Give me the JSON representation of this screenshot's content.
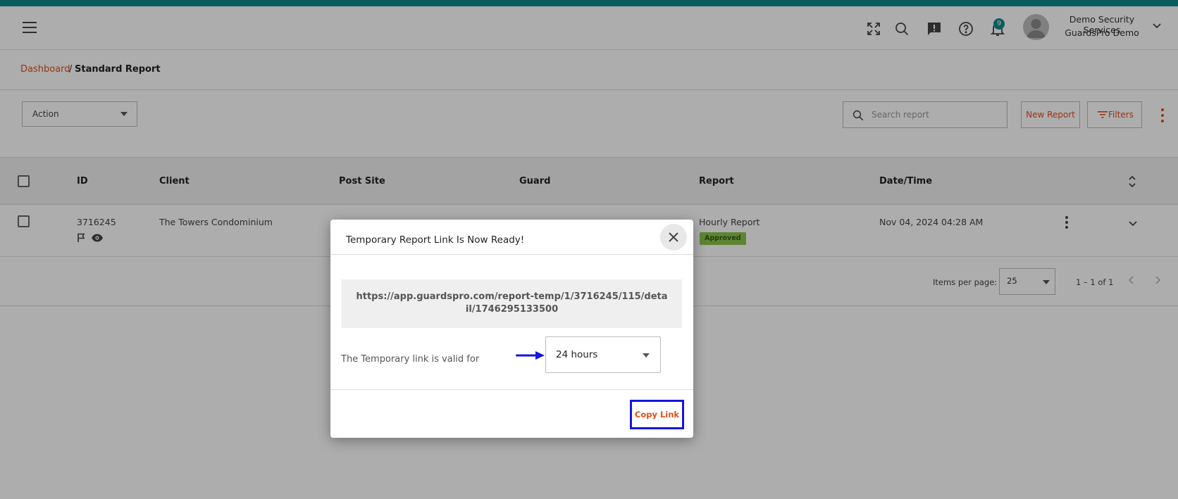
{
  "header": {
    "notification_count": "9",
    "user_name": "Demo Security Services",
    "user_org": "GuardsPro Demo"
  },
  "breadcrumb": {
    "root": "Dashboard",
    "separator": "/",
    "current": "Standard Report"
  },
  "toolbar": {
    "action_label": "Action",
    "search_placeholder": "Search report",
    "new_report_label": "New Report",
    "filters_label": "Filters"
  },
  "table": {
    "columns": [
      "ID",
      "Client",
      "Post Site",
      "Guard",
      "Report",
      "Date/Time"
    ],
    "rows": [
      {
        "id": "3716245",
        "client": "The Towers Condominium",
        "report": "Hourly Report",
        "status": "Approved",
        "datetime": "Nov 04, 2024 04:28 AM"
      }
    ]
  },
  "pagination": {
    "items_per_page_label": "Items per page:",
    "page_size": "25",
    "range": "1 – 1 of 1"
  },
  "modal": {
    "title": "Temporary Report Link Is Now Ready!",
    "link": "https://app.guardspro.com/report-temp/1/3716245/115/detail/1746295133500",
    "valid_label": "The Temporary link is valid for",
    "duration": "24 hours",
    "copy_label": "Copy Link"
  },
  "colors": {
    "accent": "#e04e1b",
    "teal": "#0e8a8a",
    "highlight": "#1515e0"
  }
}
